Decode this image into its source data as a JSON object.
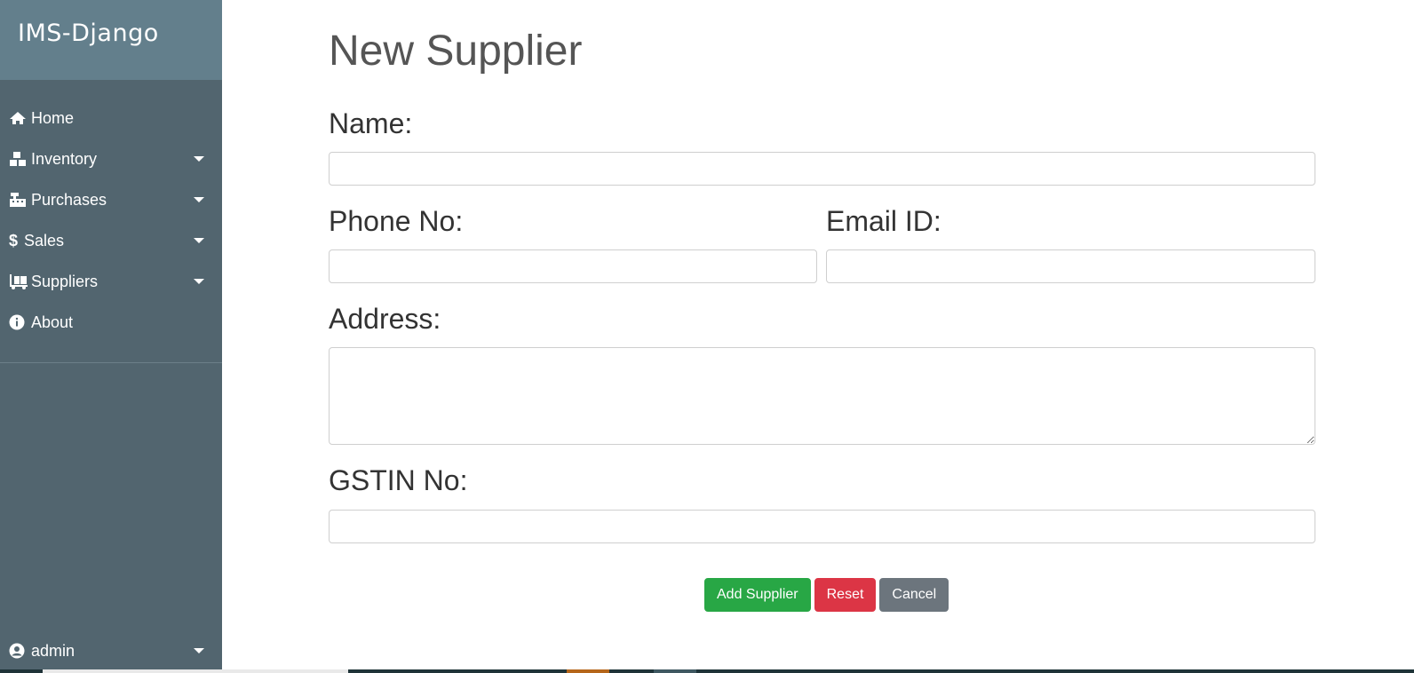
{
  "app": {
    "brand": "IMS-Django",
    "colors": {
      "sidebar_bg": "#52656f",
      "brand_bg": "#637f8c",
      "success": "#28a745",
      "danger": "#dc3545",
      "secondary": "#6c757d"
    }
  },
  "sidebar": {
    "items": [
      {
        "label": "Home",
        "icon": "home-icon",
        "dropdown": false
      },
      {
        "label": "Inventory",
        "icon": "boxes-icon",
        "dropdown": true
      },
      {
        "label": "Purchases",
        "icon": "cash-register-icon",
        "dropdown": true
      },
      {
        "label": "Sales",
        "icon": "dollar-icon",
        "dropdown": true
      },
      {
        "label": "Suppliers",
        "icon": "dolly-icon",
        "dropdown": true
      },
      {
        "label": "About",
        "icon": "info-circle-icon",
        "dropdown": false
      }
    ],
    "user": {
      "label": "admin",
      "icon": "user-circle-icon",
      "dropdown": true
    }
  },
  "form": {
    "title": "New Supplier",
    "name_label": "Name:",
    "name_value": "",
    "phone_label": "Phone No:",
    "phone_value": "",
    "email_label": "Email ID:",
    "email_value": "",
    "address_label": "Address:",
    "address_value": "",
    "gstin_label": "GSTIN No:",
    "gstin_value": ""
  },
  "buttons": {
    "add": "Add Supplier",
    "reset": "Reset",
    "cancel": "Cancel"
  }
}
